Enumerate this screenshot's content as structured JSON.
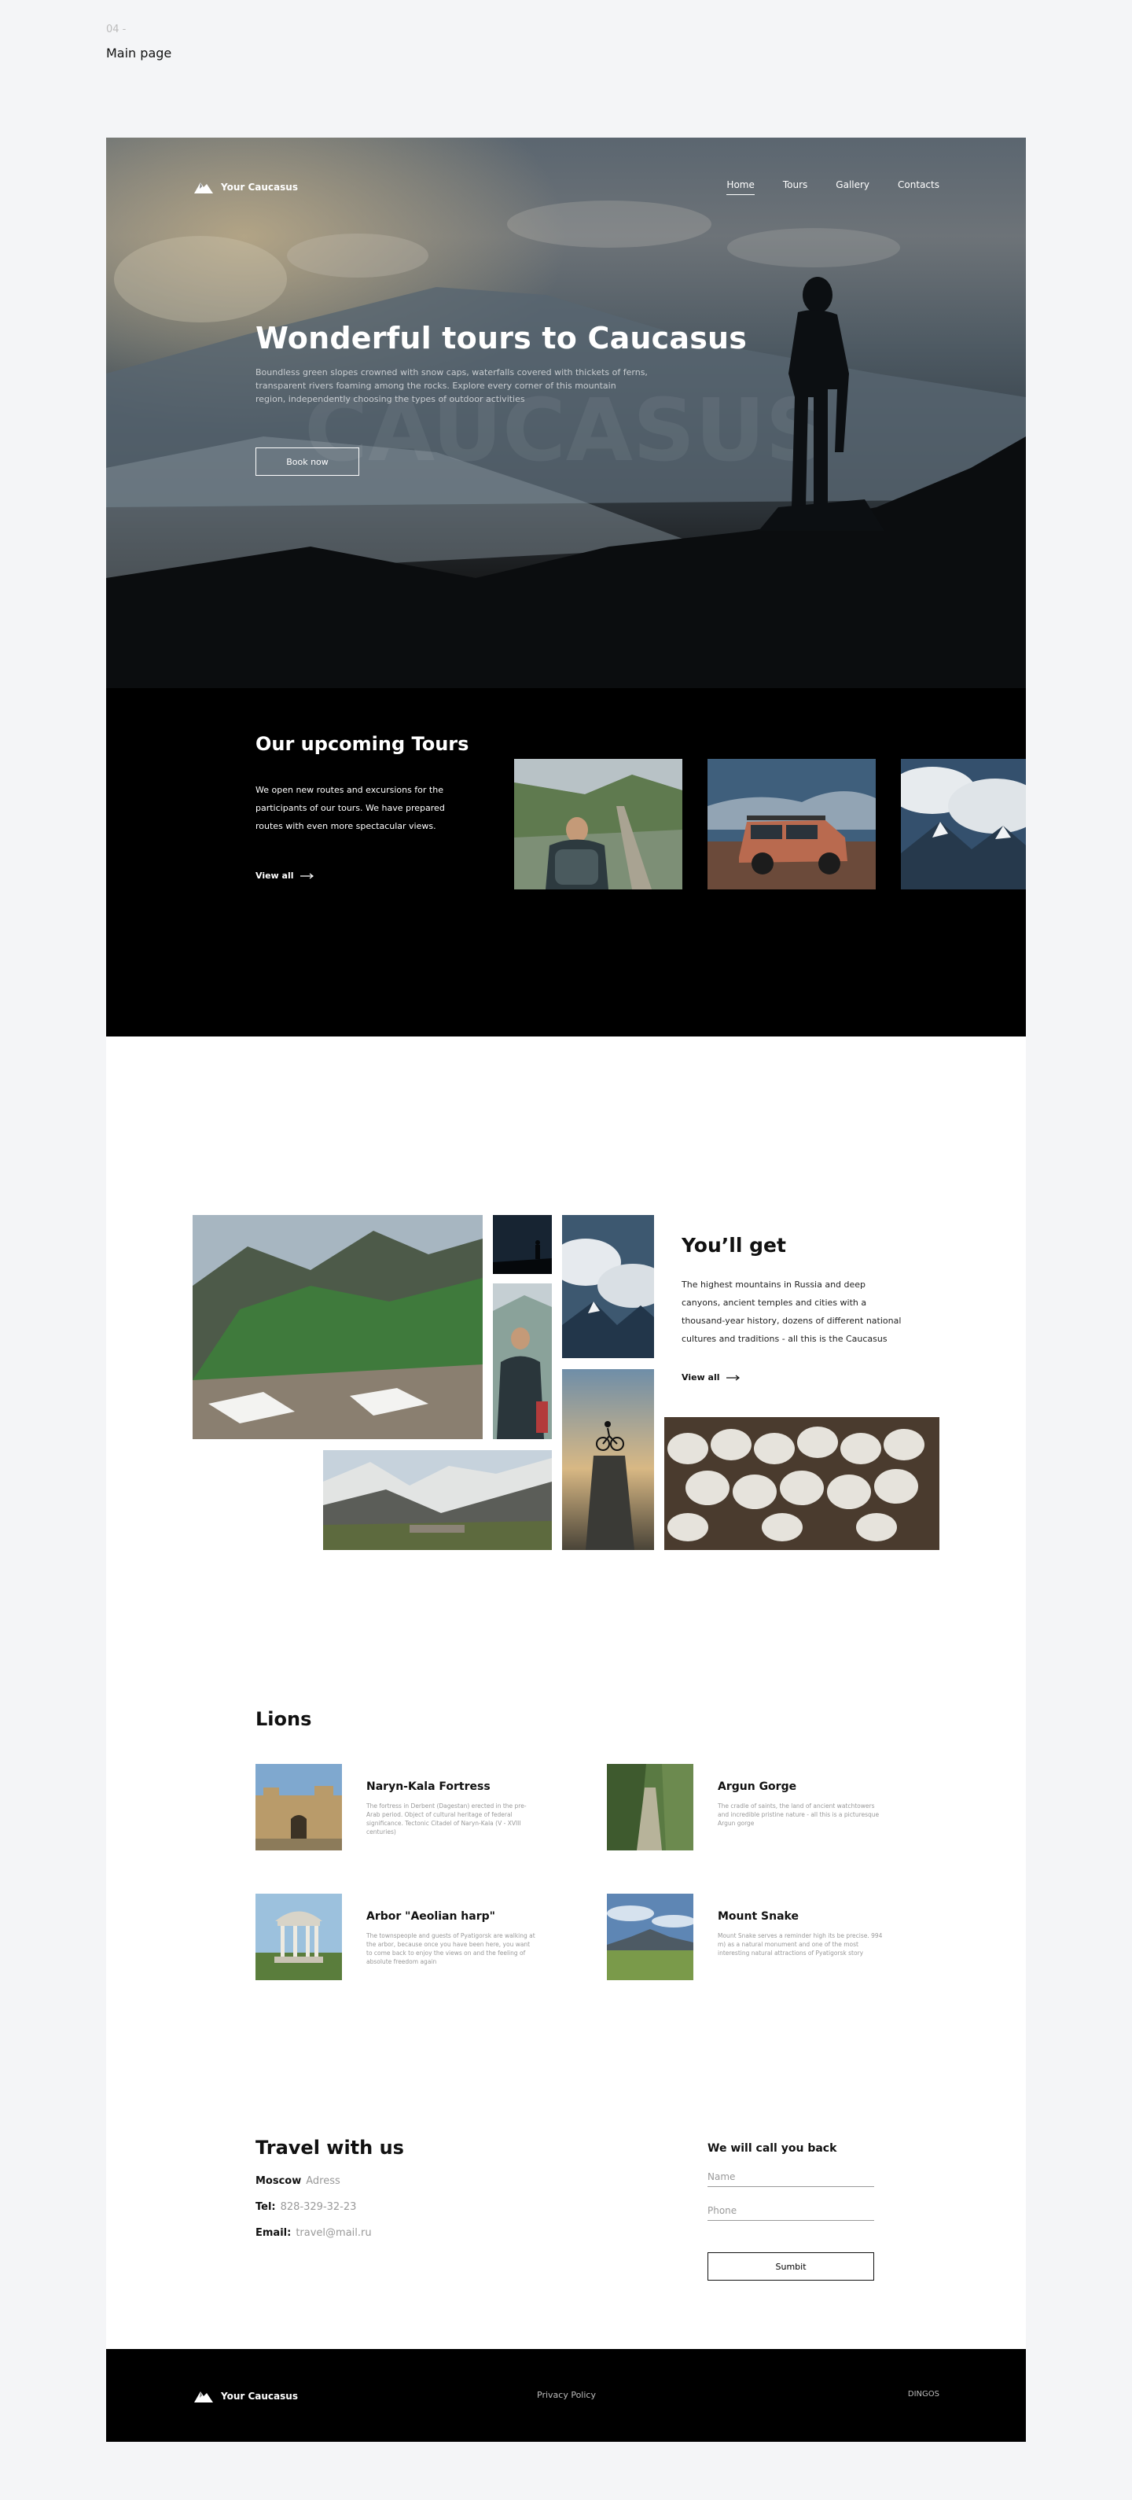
{
  "page_meta": {
    "number": "04 -",
    "title": "Main page"
  },
  "brand": {
    "name": "Your Caucasus"
  },
  "nav": {
    "items": [
      "Home",
      "Tours",
      "Gallery",
      "Contacts"
    ],
    "active": "Home"
  },
  "hero": {
    "title": "Wonderful tours to Caucasus",
    "subtitle": "Boundless green slopes crowned with snow caps, waterfalls covered with thickets of ferns, transparent rivers foaming among the rocks. Explore every corner of this mountain region, independently choosing the types of outdoor activities",
    "watermark": "CAUCASUS",
    "button": "Book now"
  },
  "tours": {
    "title": "Our upcoming Tours",
    "text": "We open new routes and excursions for the participants of our tours. We have prepared routes with even more spectacular views.",
    "link": "View all"
  },
  "get": {
    "title": "You’ll get",
    "text": "The highest mountains in Russia and deep canyons, ancient temples and cities with a thousand-year history, dozens of different national cultures and traditions - all this is the Caucasus",
    "link": "View all"
  },
  "lions": {
    "title": "Lions",
    "items": [
      {
        "title": "Naryn-Kala Fortress",
        "desc": "The fortress in Derbent (Dagestan) erected in the pre-Arab period. Object of cultural heritage of federal significance. Tectonic Citadel of Naryn-Kala (V - XVIII centuries)"
      },
      {
        "title": "Argun Gorge",
        "desc": "The cradle of saints, the land of ancient watchtowers and incredible pristine nature - all this is a picturesque Argun gorge"
      },
      {
        "title": "Arbor \"Aeolian harp\"",
        "desc": "The townspeople and guests of Pyatigorsk are walking at the arbor, because once you have been here, you want to come back to enjoy the views on and the feeling of absolute freedom again"
      },
      {
        "title": "Mount Snake",
        "desc": "Mount Snake serves a reminder high its be precise. 994 m) as a natural monument and one of the most interesting natural attractions of Pyatigorsk story"
      }
    ]
  },
  "travel": {
    "title": "Travel with us",
    "city_label": "Moscow",
    "city_value": "Adress",
    "tel_label": "Tel:",
    "tel_value": "828-329-32-23",
    "email_label": "Email:",
    "email_value": "travel@mail.ru"
  },
  "callback": {
    "title": "We will call you back",
    "name_placeholder": "Name",
    "phone_placeholder": "Phone",
    "submit": "Sumbit"
  },
  "footer": {
    "policy": "Privacy Policy",
    "brand": "DINGOS"
  }
}
